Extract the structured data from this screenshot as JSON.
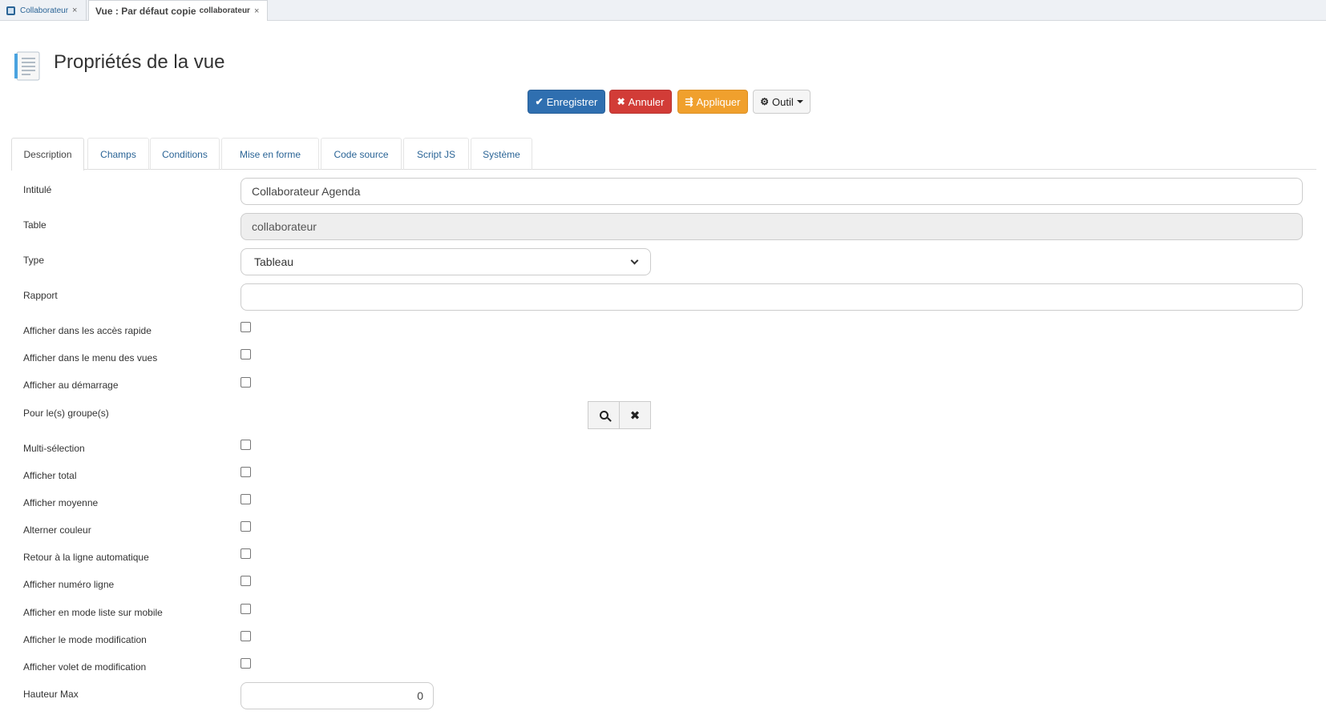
{
  "window_tabs": [
    {
      "label": "Collaborateur",
      "close": "×"
    },
    {
      "label": "Vue : Par défaut copie",
      "sub": "collaborateur",
      "close": "×"
    }
  ],
  "header": {
    "title": "Propriétés de la vue"
  },
  "actions": {
    "save": "Enregistrer",
    "cancel": "Annuler",
    "apply": "Appliquer",
    "tool": "Outil"
  },
  "tabs": [
    "Description",
    "Champs",
    "Conditions",
    "Mise en forme",
    "Code source",
    "Script JS",
    "Système"
  ],
  "form": {
    "intitule": {
      "label": "Intitulé",
      "value": "Collaborateur Agenda"
    },
    "table": {
      "label": "Table",
      "value": "collaborateur"
    },
    "type": {
      "label": "Type",
      "value": "Tableau"
    },
    "rapport": {
      "label": "Rapport",
      "value": ""
    },
    "acces_rapide": {
      "label": "Afficher dans les accès rapide"
    },
    "menu_vues": {
      "label": "Afficher dans le menu des vues"
    },
    "demarrage": {
      "label": "Afficher au démarrage"
    },
    "groupes": {
      "label": "Pour le(s) groupe(s)"
    },
    "multi": {
      "label": "Multi-sélection"
    },
    "total": {
      "label": "Afficher total"
    },
    "moyenne": {
      "label": "Afficher moyenne"
    },
    "alterner": {
      "label": "Alterner couleur"
    },
    "retour": {
      "label": "Retour à la ligne automatique"
    },
    "numero": {
      "label": "Afficher numéro ligne"
    },
    "mobile": {
      "label": "Afficher en mode liste sur mobile"
    },
    "modif": {
      "label": "Afficher le mode modification"
    },
    "volet": {
      "label": "Afficher volet de modification"
    },
    "hauteur": {
      "label": "Hauteur Max",
      "value": "0"
    }
  },
  "colors": {
    "primary": "#2f6fb0",
    "danger": "#d23c37",
    "warning": "#f0a02d",
    "link": "#2a6496"
  }
}
